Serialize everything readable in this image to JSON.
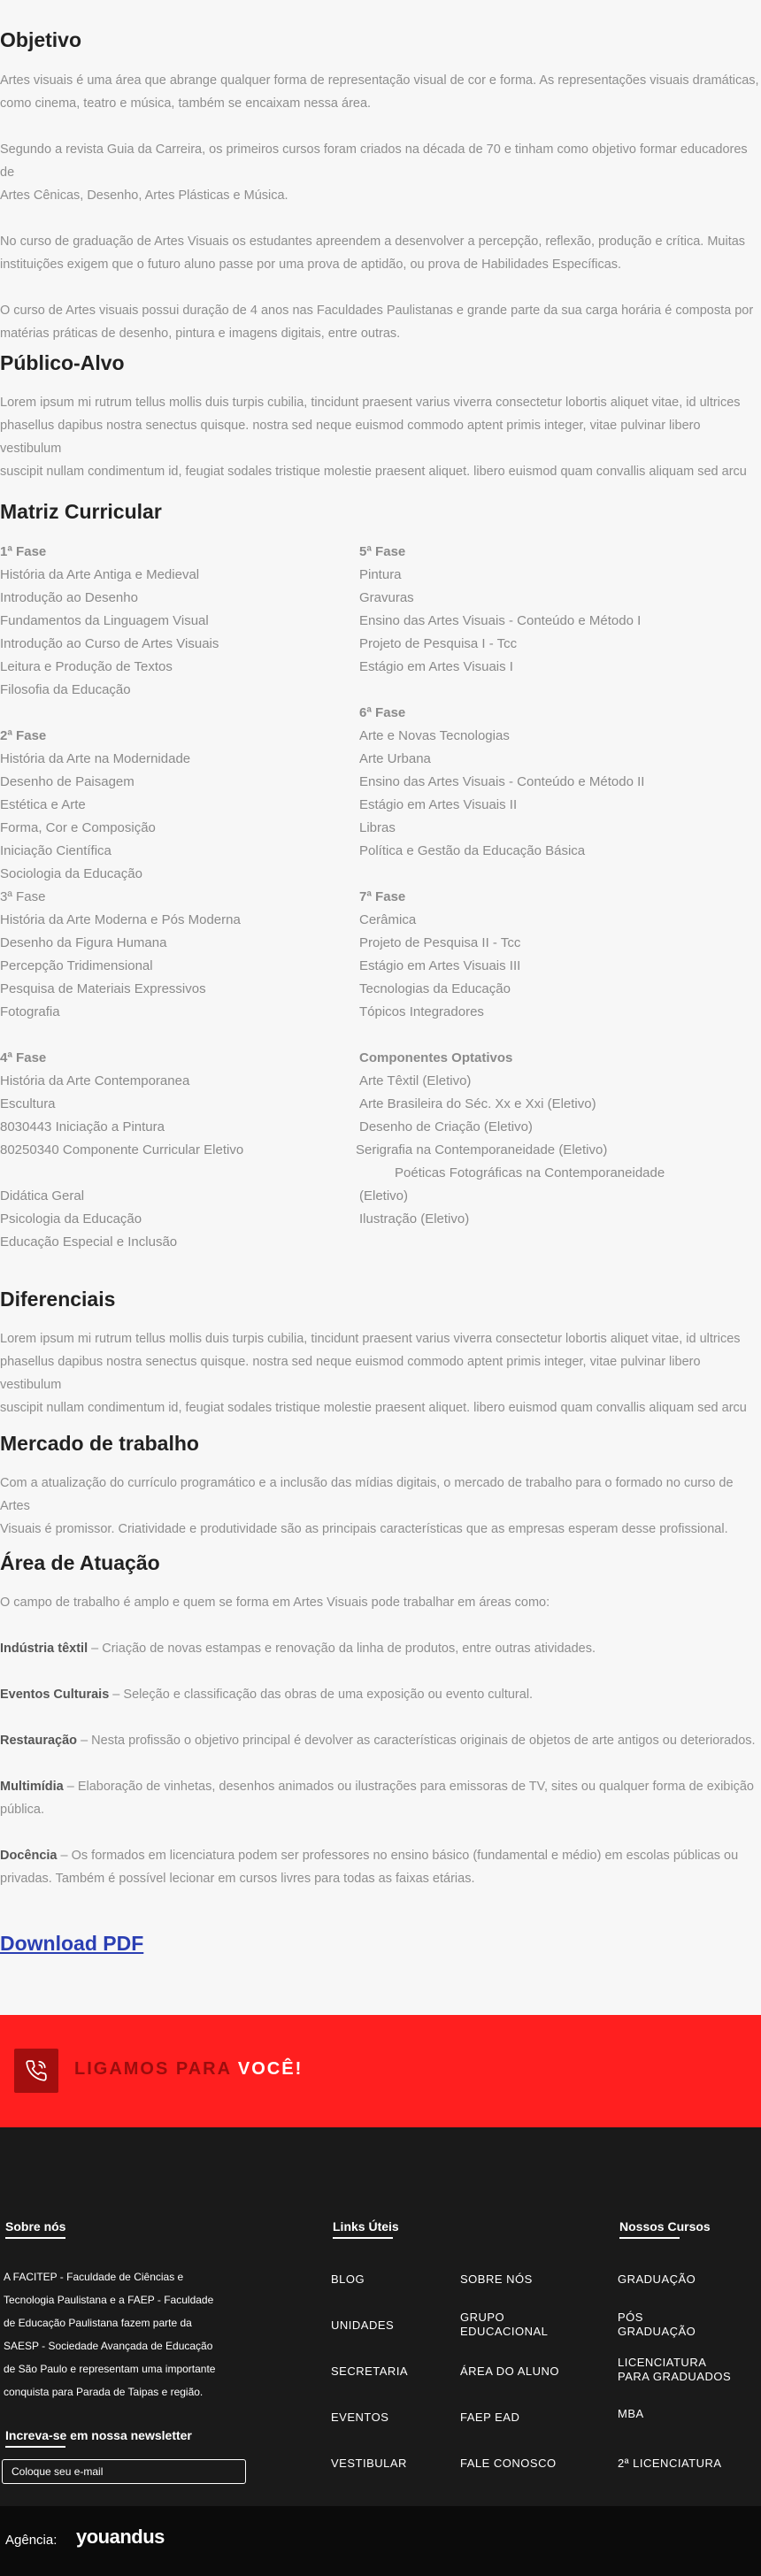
{
  "objetivo": {
    "title": "Objetivo",
    "paragraphs": [
      "Artes visuais é uma área que abrange qualquer forma de representação visual de cor e forma. As representações visuais dramáticas,",
      "como cinema, teatro e música, também se encaixam nessa área.",
      "Segundo a revista Guia da Carreira, os primeiros cursos foram criados na década de 70 e tinham como objetivo formar educadores de",
      "Artes Cênicas, Desenho, Artes Plásticas e Música.",
      "No curso de graduação de Artes Visuais os estudantes apreendem a desenvolver a percepção, reflexão, produção e crítica. Muitas",
      "instituições exigem que o futuro aluno passe por uma prova de aptidão, ou prova de Habilidades Específicas.",
      "O curso de Artes visuais possui duração de 4 anos nas Faculdades Paulistanas e grande parte da sua carga horária é composta por",
      "matérias práticas de desenho, pintura e imagens digitais, entre outras."
    ]
  },
  "publico": {
    "title": "Público-Alvo",
    "lines": [
      "Lorem ipsum mi rutrum tellus mollis duis turpis cubilia, tincidunt praesent varius viverra consectetur lobortis aliquet vitae, id ultrices",
      "phasellus dapibus nostra senectus quisque. nostra sed neque euismod commodo aptent primis integer, vitae pulvinar libero vestibulum",
      "suscipit nullam condimentum id, feugiat sodales tristique molestie praesent aliquet. libero euismod quam convallis aliquam sed arcu"
    ]
  },
  "matriz": {
    "title": "Matriz Curricular",
    "left": [
      {
        "t": "1ª Fase",
        "h": true
      },
      {
        "t": "História da Arte Antiga e Medieval"
      },
      {
        "t": "Introdução ao Desenho"
      },
      {
        "t": "Fundamentos da Linguagem Visual"
      },
      {
        "t": "Introdução ao Curso de Artes Visuais"
      },
      {
        "t": "Leitura e Produção de Textos"
      },
      {
        "t": "Filosofia da Educação"
      },
      {
        "t": ""
      },
      {
        "t": "2ª Fase",
        "h": true
      },
      {
        "t": "História da Arte na Modernidade"
      },
      {
        "t": "Desenho de Paisagem"
      },
      {
        "t": "Estética e Arte"
      },
      {
        "t": "Forma, Cor e Composição"
      },
      {
        "t": "Iniciação Científica"
      },
      {
        "t": "Sociologia da Educação"
      },
      {
        "t": "3ª Fase"
      },
      {
        "t": "História da Arte Moderna e Pós Moderna"
      },
      {
        "t": "Desenho da Figura Humana"
      },
      {
        "t": "Percepção Tridimensional"
      },
      {
        "t": "Pesquisa de Materiais Expressivos"
      },
      {
        "t": "Fotografia"
      },
      {
        "t": ""
      },
      {
        "t": "4ª Fase",
        "h": true
      },
      {
        "t": "História da Arte Contemporanea"
      },
      {
        "t": "Escultura"
      },
      {
        "t": "8030443   Iniciação a Pintura"
      },
      {
        "t": "80250340 Componente Curricular Eletivo"
      },
      {
        "t": ""
      },
      {
        "t": "Didática Geral"
      },
      {
        "t": "Psicologia da Educação"
      },
      {
        "t": "Educação Especial e Inclusão"
      }
    ],
    "right": [
      {
        "t": "5ª Fase",
        "h": true
      },
      {
        "t": "Pintura"
      },
      {
        "t": "Gravuras"
      },
      {
        "t": "Ensino das Artes Visuais - Conteúdo e Método I"
      },
      {
        "t": "Projeto de Pesquisa I - Tcc"
      },
      {
        "t": "Estágio em Artes Visuais I"
      },
      {
        "t": ""
      },
      {
        "t": "6ª Fase",
        "h": true
      },
      {
        "t": "Arte e Novas Tecnologias"
      },
      {
        "t": "Arte Urbana"
      },
      {
        "t": "Ensino das Artes Visuais - Conteúdo e Método II"
      },
      {
        "t": "Estágio em Artes Visuais II"
      },
      {
        "t": "Libras"
      },
      {
        "t": "Política e Gestão da Educação Básica"
      },
      {
        "t": ""
      },
      {
        "t": "7ª Fase",
        "h": true
      },
      {
        "t": "Cerâmica"
      },
      {
        "t": "Projeto de Pesquisa II - Tcc"
      },
      {
        "t": "Estágio em Artes Visuais III"
      },
      {
        "t": "Tecnologias da Educação"
      },
      {
        "t": "Tópicos Integradores"
      },
      {
        "t": ""
      },
      {
        "t": "Componentes Optativos",
        "h": true
      },
      {
        "t": "Arte Têxtil (Eletivo)"
      },
      {
        "t": "Arte Brasileira do Séc. Xx e Xxi (Eletivo)"
      },
      {
        "t": "Desenho de Criação (Eletivo)"
      },
      {
        "t": "Serigrafia na Contemporaneidade (Eletivo)",
        "shift": -4
      },
      {
        "t": "Poéticas Fotográficas na Contemporaneidade",
        "shift": 40
      },
      {
        "t": "(Eletivo)"
      },
      {
        "t": "Ilustração (Eletivo)"
      }
    ]
  },
  "diferenciais": {
    "title": "Diferenciais",
    "lines": [
      "Lorem ipsum mi rutrum tellus mollis duis turpis cubilia, tincidunt praesent varius viverra consectetur lobortis aliquet vitae, id ultrices",
      "phasellus dapibus nostra senectus quisque. nostra sed neque euismod commodo aptent primis integer, vitae pulvinar libero vestibulum",
      "suscipit nullam condimentum id, feugiat sodales tristique molestie praesent aliquet. libero euismod quam convallis aliquam sed arcu"
    ]
  },
  "mercado": {
    "title": "Mercado de trabalho",
    "lines": [
      "Com a atualização do currículo programático e a inclusão das mídias digitais, o mercado de trabalho para o formado no curso de Artes",
      "Visuais é promissor. Criatividade e produtividade são as principais características que as empresas esperam desse profissional."
    ]
  },
  "area": {
    "title": "Área de Atuação",
    "intro": "O campo de trabalho é amplo e quem se forma em Artes Visuais pode trabalhar em áreas como:",
    "items": [
      {
        "term": "Indústria têxtil",
        "l1": " – Criação de novas estampas e renovação da linha de produtos, entre outras atividades.",
        "l2": ""
      },
      {
        "term": "Eventos Culturais",
        "l1": " – Seleção e classificação das obras de uma exposição ou evento cultural.",
        "l2": ""
      },
      {
        "term": "Restauração",
        "l1": " – Nesta profissão o objetivo principal é devolver as características originais de objetos de arte antigos ou deteriorados.",
        "l2": ""
      },
      {
        "term": "Multimídia",
        "l1": " – Elaboração de vinhetas, desenhos animados ou ilustrações para emissoras de TV, sites ou qualquer forma de exibição",
        "l2": "pública."
      },
      {
        "term": "Docência",
        "l1": " – Os formados em licenciatura podem ser professores no ensino básico (fundamental e médio) em escolas públicas ou",
        "l2": "privadas. Também é possível lecionar em cursos livres para todas as faixas etárias."
      }
    ]
  },
  "download": {
    "label": "Download PDF"
  },
  "cta": {
    "prefix": "LIGAMOS PARA ",
    "strong": "VOCÊ!",
    "icon": "phone-icon",
    "bg": "#ff1f1f"
  },
  "footer": {
    "about_title": "Sobre nós",
    "about_lines": [
      "A FACITEP - Faculdade de Ciências e",
      "Tecnologia Paulistana e a FAEP - Faculdade",
      "de Educação Paulistana fazem parte da",
      "SAESP - Sociedade Avançada de Educação",
      "de São Paulo e representam uma importante",
      "conquista para Parada de Taipas e região."
    ],
    "newsletter_title": "Increva-se em nossa newsletter",
    "newsletter_placeholder": "Coloque seu e-mail",
    "links_title": "Links Úteis",
    "links_col1": [
      "BLOG",
      "UNIDADES",
      "SECRETARIA",
      "EVENTOS",
      "VESTIBULAR"
    ],
    "links_col2": [
      [
        "SOBRE NÓS"
      ],
      [
        "GRUPO",
        "EDUCACIONAL"
      ],
      [
        "ÁREA DO ALUNO"
      ],
      [
        "FAEP EAD"
      ],
      [
        "FALE CONOSCO"
      ]
    ],
    "courses_title": "Nossos Cursos",
    "courses": [
      [
        "GRADUAÇÃO"
      ],
      [
        "PÓS",
        "GRADUAÇÃO"
      ],
      [
        "LICENCIATURA",
        "PARA GRADUADOS"
      ],
      [
        "MBA"
      ],
      [
        "2ª LICENCIATURA"
      ]
    ]
  },
  "bottom": {
    "agencia": "Agência:",
    "logo": "youandus"
  }
}
